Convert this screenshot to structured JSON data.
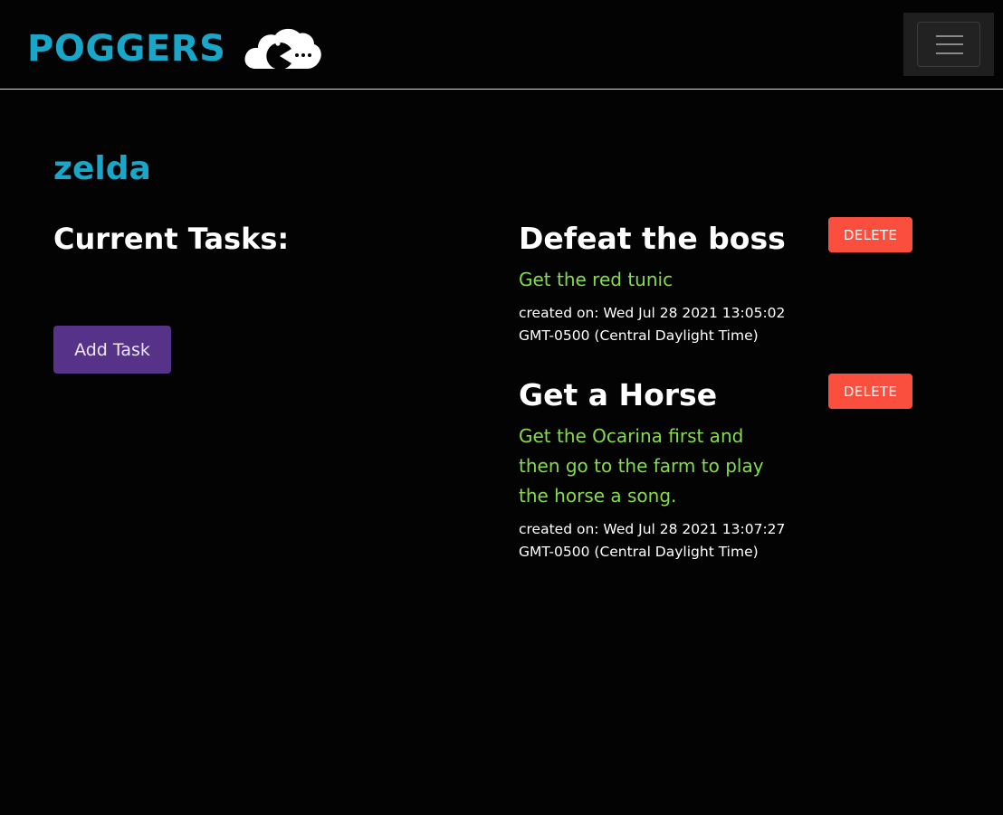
{
  "navbar": {
    "brand": "POGGERS",
    "logo_icon": "cloud-pacman-icon",
    "menu_icon": "hamburger-menu-icon"
  },
  "user": {
    "name": "zelda"
  },
  "tasks_section": {
    "heading": "Current Tasks:",
    "add_button": "Add Task"
  },
  "tasks": [
    {
      "title": "Defeat the boss",
      "description": "Get the red tunic",
      "created": "created on: Wed Jul 28 2021 13:05:02 GMT-0500 (Central Daylight Time)",
      "delete_label": "DELETE"
    },
    {
      "title": "Get a Horse",
      "description": "Get the Ocarina first and then go to the farm to play the horse a song.",
      "created": "created on: Wed Jul 28 2021 13:07:27 GMT-0500 (Central Daylight Time)",
      "delete_label": "DELETE"
    }
  ],
  "colors": {
    "background": "#030303",
    "brand": "#19a7c9",
    "add_button": "#563289",
    "delete_button": "#fa4f3f",
    "description": "#84dc4a"
  }
}
